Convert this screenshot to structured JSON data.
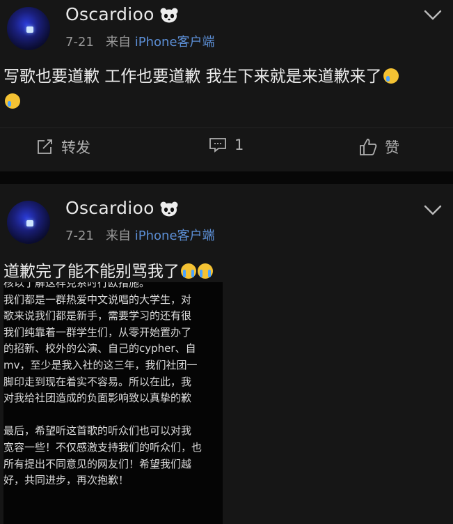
{
  "posts": [
    {
      "username": "Oscardioo",
      "date": "7-21",
      "from_label": "来自",
      "source": "iPhone客户端",
      "text_line1": "写歌也要道歉 工作也要道歉 我生下来就是来道歉来了",
      "actions": {
        "repost": "转发",
        "comment_count": "1",
        "like": "赞"
      }
    },
    {
      "username": "Oscardioo",
      "date": "7-21",
      "from_label": "来自",
      "source": "iPhone客户端",
      "text": "道歉完了能不能别骂我了",
      "image_lines": [
        "核以了解这样克系时行欧措施。",
        "  我们都是一群热爱中文说唱的大学生，对",
        "歌来说我们都是新手，需要学习的还有很",
        "  我们纯靠着一群学生们，从零开始置办了",
        "的招新、校外的公演、自己的cypher、自",
        "mv，至少是我入社的这三年，我们社团一",
        "脚印走到现在着实不容易。所以在此，我",
        "对我给社团造成的负面影响致以真挚的歉",
        "",
        "  最后，希望听这首歌的听众们也可以对我",
        "宽容一些！不仅感激支持我们的听众们，也",
        "所有提出不同意见的网友们！希望我们越",
        "好，共同进步，再次抱歉！"
      ]
    }
  ],
  "icons": {
    "avatar": "avatar",
    "badge": "panda-icon",
    "menu": "chevron-down-icon",
    "repost": "repost-icon",
    "comment": "comment-icon",
    "like": "thumbs-up-icon",
    "emoji1": "tears-of-joy-emoji",
    "emoji2": "crying-emoji"
  },
  "colors": {
    "source_link": "#5c8fd6",
    "background": "#161616"
  }
}
